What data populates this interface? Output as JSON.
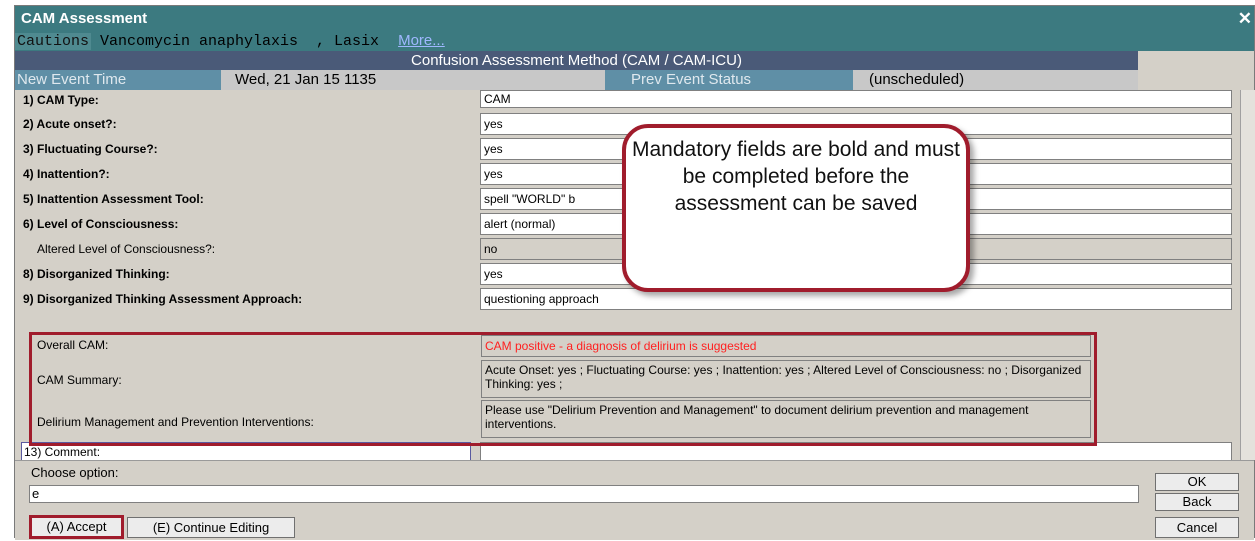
{
  "window": {
    "title": "CAM Assessment",
    "close_glyph": "✕"
  },
  "cautions": {
    "label": "Cautions",
    "text": " Vancomycin anaphylaxis  , Lasix ",
    "more_link": "More..."
  },
  "form_title": "Confusion Assessment Method (CAM / CAM-ICU)",
  "event": {
    "new_time_label": "New Event Time",
    "new_time_value": "Wed, 21 Jan 15 1135",
    "prev_status_label": "Prev Event Status",
    "prev_status_value": "(unscheduled)"
  },
  "fields": [
    {
      "label": "1) CAM Type:",
      "value": "CAM"
    },
    {
      "label": "2) Acute onset?:",
      "value": "yes"
    },
    {
      "label": "3) Fluctuating Course?:",
      "value": "yes"
    },
    {
      "label": "4) Inattention?:",
      "value": "yes"
    },
    {
      "label": "5) Inattention Assessment Tool:",
      "value": "spell \"WORLD\" b"
    },
    {
      "label": "6) Level of Consciousness:",
      "value": "alert (normal)"
    },
    {
      "label": "Altered Level of Consciousness?:",
      "value": "no"
    },
    {
      "label": "8) Disorganized Thinking:",
      "value": "yes"
    },
    {
      "label": "9) Disorganized Thinking Assessment Approach:",
      "value": "questioning approach"
    },
    {
      "label": "Overall CAM:",
      "value": "CAM positive - a diagnosis of delirium is suggested"
    },
    {
      "label": "CAM Summary:",
      "value": "Acute Onset: yes ; Fluctuating Course: yes ; Inattention: yes ; Altered Level of Consciousness: no ; Disorganized Thinking: yes ;"
    },
    {
      "label": "Delirium Management and Prevention Interventions:",
      "value": "Please use \"Delirium Prevention and Management\" to document delirium prevention and management interventions."
    },
    {
      "label": "13) Comment:",
      "value": ""
    }
  ],
  "callout": "Mandatory fields are bold and must be completed before the assessment can be saved",
  "bottom": {
    "choose_label": "Choose option:",
    "option_value": "e",
    "accept": "(A) Accept",
    "continue": "(E) Continue Editing",
    "ok": "OK",
    "back": "Back",
    "cancel": "Cancel"
  },
  "colors": {
    "title_bar": "#3c7a80",
    "highlight_red": "#a01c2c",
    "alert_text": "#ff2020"
  }
}
